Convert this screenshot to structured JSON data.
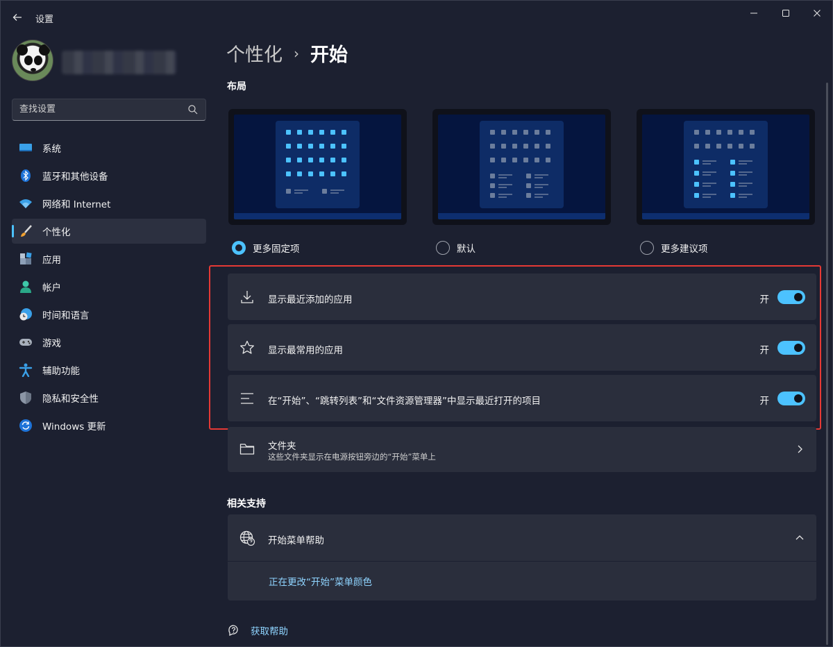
{
  "window": {
    "title": "设置"
  },
  "sidebar": {
    "search_placeholder": "查找设置",
    "items": [
      {
        "label": "系统",
        "icon": "monitor-icon"
      },
      {
        "label": "蓝牙和其他设备",
        "icon": "bluetooth-icon"
      },
      {
        "label": "网络和 Internet",
        "icon": "wifi-icon"
      },
      {
        "label": "个性化",
        "icon": "brush-icon",
        "active": true
      },
      {
        "label": "应用",
        "icon": "apps-icon"
      },
      {
        "label": "帐户",
        "icon": "person-icon"
      },
      {
        "label": "时间和语言",
        "icon": "globe-clock-icon"
      },
      {
        "label": "游戏",
        "icon": "gamepad-icon"
      },
      {
        "label": "辅助功能",
        "icon": "accessibility-icon"
      },
      {
        "label": "隐私和安全性",
        "icon": "shield-icon"
      },
      {
        "label": "Windows 更新",
        "icon": "update-icon"
      }
    ]
  },
  "breadcrumb": {
    "parent": "个性化",
    "separator": "›",
    "current": "开始"
  },
  "layout_section": {
    "title": "布局",
    "options": [
      {
        "label": "更多固定项",
        "checked": true
      },
      {
        "label": "默认",
        "checked": false
      },
      {
        "label": "更多建议项",
        "checked": false
      }
    ]
  },
  "settings": [
    {
      "label": "显示最近添加的应用",
      "icon": "download-icon",
      "state": "开",
      "on": true
    },
    {
      "label": "显示最常用的应用",
      "icon": "star-icon",
      "state": "开",
      "on": true
    },
    {
      "label": "在“开始”、“跳转列表”和“文件资源管理器”中显示最近打开的项目",
      "icon": "list-icon",
      "state": "开",
      "on": true
    }
  ],
  "folders": {
    "title": "文件夹",
    "subtitle": "这些文件夹显示在电源按钮旁边的“开始”菜单上"
  },
  "related": {
    "title": "相关支持",
    "help_title": "开始菜单帮助",
    "help_link": "正在更改“开始”菜单颜色"
  },
  "get_help": "获取帮助",
  "colors": {
    "accent": "#4cc2ff",
    "background": "#1c2030",
    "card": "#2a2e3c",
    "highlight": "#e53935"
  }
}
